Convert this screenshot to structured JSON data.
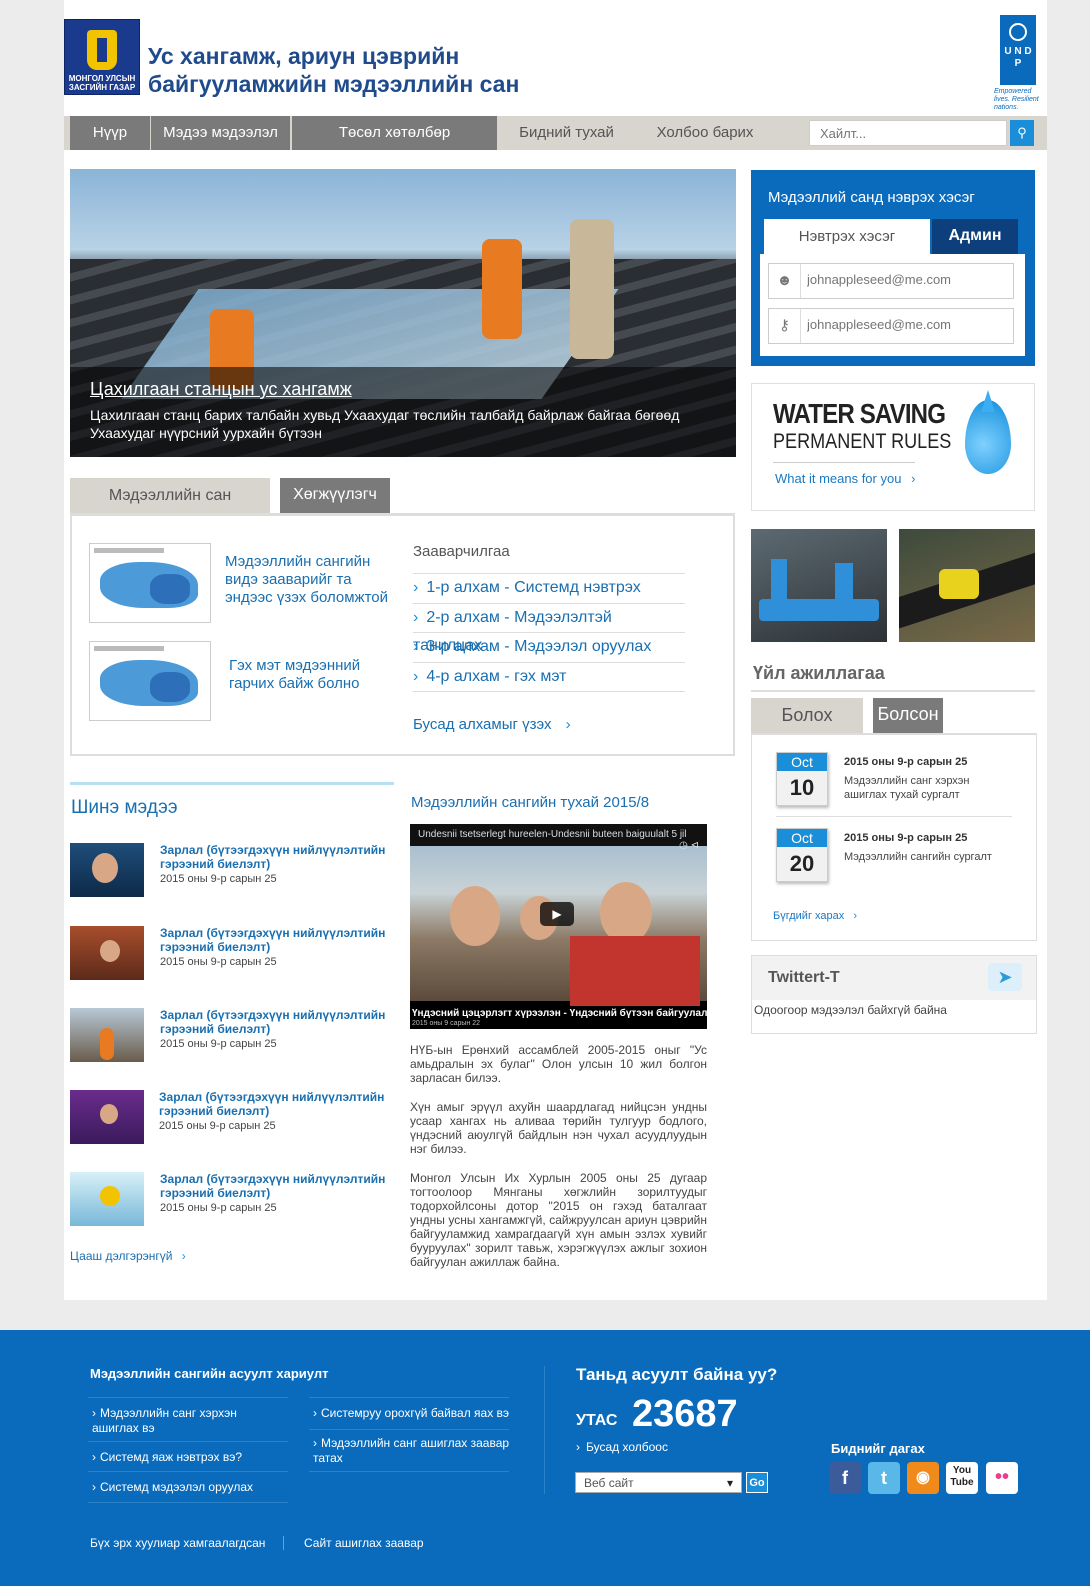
{
  "header": {
    "gov_logo_text": "МОНГОЛ УЛСЫН ЗАСГИЙН ГАЗАР",
    "title_line1": "Ус хангамж, ариун цэврийн",
    "title_line2": "байгууламжийн мэдээллийн сан",
    "undp_logo": "U N D P",
    "undp_tagline": "Empowered lives. Resilient nations."
  },
  "nav": {
    "items": [
      "Нүүр",
      "Мэдээ мэдээлэл",
      "Төсөл хөтөлбөр",
      "Бидний тухай",
      "Холбоо барих"
    ],
    "search_placeholder": "Хайлт...",
    "search_icon": "search-icon"
  },
  "hero": {
    "title": "Цахилгаан станцын ус хангамж",
    "text": "Цахилгаан станц барих талбайн хувьд Ухаахудаг төслийн талбайд байрлаж байгаа бөгөөд Ухаахудаг нүүрсний уурхайн бүтээн"
  },
  "login": {
    "title": "Мэдээллий санд нэврэх хэсэг",
    "tab_user": "Нэвтрэх хэсэг",
    "tab_admin": "Админ",
    "user_placeholder": "johnappleseed@me.com",
    "pass_placeholder": "johnappleseed@me.com",
    "user_icon": "user-icon",
    "key_icon": "key-icon"
  },
  "ad": {
    "line1": "WATER SAVING",
    "line2": "PERMANENT RULES",
    "link": "What it means for you"
  },
  "activity": {
    "title": "Үйл ажиллагаа",
    "tab_upcoming": "Болох",
    "tab_done": "Болсон",
    "events": [
      {
        "month": "Oct",
        "day": "10",
        "date": "2015 оны 9-р сарын 25",
        "desc": "Мэдээллийн санг хэрхэн ашиглах тухай сургалт"
      },
      {
        "month": "Oct",
        "day": "20",
        "date": "2015 оны 9-р сарын 25",
        "desc": "Мэдээллийн сангийн сургалт"
      }
    ],
    "more": "Бүгдийг харах"
  },
  "twitter": {
    "title": "Twittert-T",
    "empty": "Одоогоор мэдээлэл байхгүй байна"
  },
  "database": {
    "tab_db": "Мэдээллийн сан",
    "tab_dev": "Хөгжүүлэгч",
    "link1": "Мэдээллийн сангийн видэ зааварийг та эндээс үзэх боломжтой",
    "link2": "Гэх мэт мэдээнний гарчих байж болно",
    "guide_title": "Зааварчилгаа",
    "steps": [
      "1-р алхам - Системд нэвтрэх",
      "2-р алхам  - Мэдээлэлтэй танилцах",
      "3-р алхам - Мэдээлэл оруулах",
      "4-р алхам - гэх мэт"
    ],
    "more_steps": "Бусад алхамыг үзэх"
  },
  "news": {
    "title": "Шинэ мэдээ",
    "items": [
      {
        "headline": "Зарлал (бүтээгдэхүүн нийлүүлэлтийн гэрээний биелэлт)",
        "date": "2015 оны 9-р сарын 25"
      },
      {
        "headline": "Зарлал (бүтээгдэхүүн нийлүүлэлтийн гэрээний биелэлт)",
        "date": "2015 оны 9-р сарын 25"
      },
      {
        "headline": "Зарлал (бүтээгдэхүүн нийлүүлэлтийн гэрээний биелэлт)",
        "date": "2015 оны 9-р сарын 25"
      },
      {
        "headline": "Зарлал (бүтээгдэхүүн нийлүүлэлтийн гэрээний биелэлт)",
        "date": "2015 оны 9-р сарын 25"
      },
      {
        "headline": "Зарлал (бүтээгдэхүүн нийлүүлэлтийн гэрээний биелэлт)",
        "date": "2015 оны 9-р сарын 25"
      }
    ],
    "more": "Цааш дэлгэрэнгүй"
  },
  "video": {
    "title": "Мэдээллийн сангийн тухай 2015/8",
    "top_text": "Undesnii tsetserlegt hureelen-Undesnii buteen baiguulalt 5 jil",
    "caption": "Үндэсний цэцэрлэгт хүрээлэн - Үндэсний бүтээн байгуулалт",
    "sub": "2015 оны 9 сарын 22",
    "paragraphs": [
      "НҮБ-ын Ерөнхий ассамблей 2005-2015 оныг \"Ус амьдралын эх булаг\" Олон улсын 10 жил болгон зарласан билээ.",
      "Хүн амыг эрүүл ахуйн шаардлагад нийцсэн ундны усаар хангах нь аливаа төрийн тулгуур бодлого, үндэсний аюулгүй байдлын нэн чухал асуудлуудын нэг билээ.",
      "Монгол Улсын Их Хурлын 2005 оны 25 дугаар тогтоолоор Мянганы хөгжлийн зорилтуудыг тодорхойлсоны дотор \"2015 он гэхэд баталгаат ундны усны хангамжгүй, сайжруулсан ариун цэврийн байгууламжид хамрагдаагүй хүн амын эзлэх хувийг бууруулах\" зорилт тавьж, хэрэгжүүлэх ажлыг зохион байгуулан ажиллаж байна."
    ]
  },
  "footer": {
    "faq_title": "Мэдээллийн сангийн асуулт хариулт",
    "faq": [
      "Мэдээллийн санг хэрхэн ашиглах вэ",
      "Системд яаж нэвтрэх вэ?",
      "Системд мэдээлэл оруулах",
      "Системруу орохгүй байвал яах вэ",
      "Мэдээллийн санг ашиглах заавар татах"
    ],
    "question": "Таньд асуулт байна уу?",
    "phone_label": "УТАС",
    "phone": "23687",
    "other_links": "Бусад холбоос",
    "site_select": "Веб сайт",
    "go": "Go",
    "follow": "Биднийг дагах",
    "social": [
      "facebook-icon",
      "twitter-icon",
      "rss-icon",
      "youtube-icon",
      "flickr-icon"
    ],
    "youtube_label": "You Tube",
    "copyright": "Бүх эрх хуулиар хамгаалагдсан",
    "site_guide": "Сайт ашиглах заавар"
  }
}
